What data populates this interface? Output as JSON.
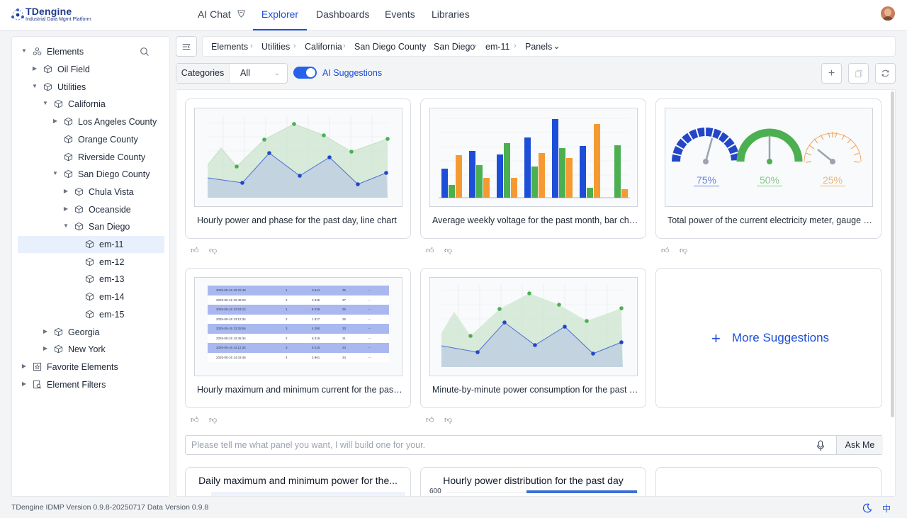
{
  "brand": {
    "name": "TDengine",
    "tagline": "Industrial Data Mgmt Platform"
  },
  "nav": {
    "tabs": [
      {
        "label": "AI Chat",
        "active": false
      },
      {
        "label": "Explorer",
        "active": true
      },
      {
        "label": "Dashboards",
        "active": false
      },
      {
        "label": "Events",
        "active": false
      },
      {
        "label": "Libraries",
        "active": false
      }
    ]
  },
  "sidebar": {
    "root": "Elements",
    "items": [
      {
        "label": "Oil Field",
        "level": 1
      },
      {
        "label": "Utilities",
        "level": 1
      },
      {
        "label": "California",
        "level": 2
      },
      {
        "label": "Los Angeles County",
        "level": 3
      },
      {
        "label": "Orange County",
        "level": 3
      },
      {
        "label": "Riverside County",
        "level": 3
      },
      {
        "label": "San Diego County",
        "level": 3
      },
      {
        "label": "Chula Vista",
        "level": 4
      },
      {
        "label": "Oceanside",
        "level": 4
      },
      {
        "label": "San Diego",
        "level": 4
      },
      {
        "label": "em-11",
        "level": 5,
        "selected": true
      },
      {
        "label": "em-12",
        "level": 5
      },
      {
        "label": "em-13",
        "level": 5
      },
      {
        "label": "em-14",
        "level": 5
      },
      {
        "label": "em-15",
        "level": 5
      },
      {
        "label": "Georgia",
        "level": 2
      },
      {
        "label": "New York",
        "level": 2
      }
    ],
    "favorites": "Favorite Elements",
    "filters": "Element Filters"
  },
  "breadcrumb": [
    "Elements",
    "Utilities",
    "California",
    "San Diego County",
    "San Diego",
    "em-11",
    "Panels"
  ],
  "filter": {
    "label": "Categories",
    "value": "All"
  },
  "ai_suggestions": {
    "label": "AI Suggestions",
    "enabled": true
  },
  "cards": [
    {
      "caption": "Hourly power and phase for the past day, line chart"
    },
    {
      "caption": "Average weekly voltage for the past month, bar chart"
    },
    {
      "caption": "Total power of the current electricity meter, gauge chart",
      "gauges": [
        "75%",
        "50%",
        "25%"
      ]
    },
    {
      "caption": "Hourly maximum and minimum current for the past week, table"
    },
    {
      "caption": "Minute-by-minute power consumption for the past hour, area chart"
    }
  ],
  "table_preview": [
    [
      "2025-05-16 10:22:48",
      "1",
      "3.544",
      "35",
      "--"
    ],
    [
      "2025-05-16 12:45:23",
      "2",
      "2.345",
      "37",
      "--"
    ],
    [
      "2025-05-16 12:53:12",
      "1",
      "8.239",
      "26",
      "--"
    ],
    [
      "2025-05-16 13:12:34",
      "2",
      "1.317",
      "25",
      "--"
    ],
    [
      "2025-05-16 13:25:56",
      "3",
      "4.290",
      "33",
      "--"
    ],
    [
      "2025-05-16 13:45:34",
      "2",
      "6.316",
      "21",
      "--"
    ],
    [
      "2025-05-16 14:12:34",
      "3",
      "5.215",
      "23",
      "--"
    ],
    [
      "2025-05-16 14:33:46",
      "4",
      "3.961",
      "34",
      "--"
    ]
  ],
  "more_suggestions": "More Suggestions",
  "ask": {
    "placeholder": "Please tell me what panel you want, I will build one for your.",
    "button": "Ask Me"
  },
  "peek_cards": [
    {
      "title": "Daily maximum and minimum power for the..."
    },
    {
      "title": "Hourly power distribution for the past day",
      "axis_tick": "600"
    },
    {
      "title": ""
    }
  ],
  "footer": {
    "version": "TDengine IDMP Version 0.9.8-20250717 Data Version 0.9.8",
    "lang": "中"
  },
  "colors": {
    "primary": "#1d4ed8",
    "bar_blue": "#1d4ed8",
    "bar_green": "#4caf50",
    "bar_orange": "#f59a33",
    "gauge_blue": "#2346c8",
    "gauge_green": "#4caf50",
    "gauge_orange": "#f0a860"
  }
}
